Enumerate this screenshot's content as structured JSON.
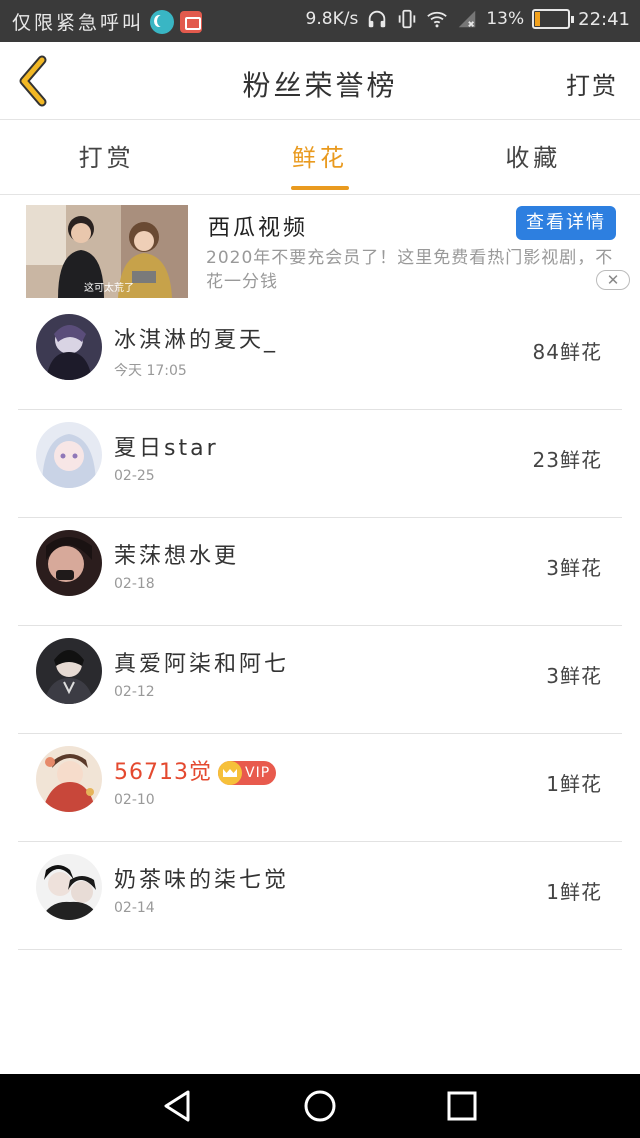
{
  "status_bar": {
    "carrier_text": "仅限紧急呼叫",
    "speed": "9.8K/s",
    "battery_pct": "13%",
    "time": "22:41"
  },
  "navbar": {
    "title": "粉丝荣誉榜",
    "action": "打赏"
  },
  "tabs": [
    {
      "label": "打赏",
      "active": false
    },
    {
      "label": "鲜花",
      "active": true
    },
    {
      "label": "收藏",
      "active": false
    }
  ],
  "ad": {
    "thumb_caption": "这可太荒了",
    "title": "西瓜视频",
    "button": "查看详情",
    "desc": "2020年不要充会员了！这里免费看热门影视剧，不花一分钱",
    "close": "✕"
  },
  "rows": [
    {
      "name": "冰淇淋的夏天_",
      "date": "今天 17:05",
      "count": "84鲜花",
      "vip": false
    },
    {
      "name": "夏日star",
      "date": "02-25",
      "count": "23鲜花",
      "vip": false
    },
    {
      "name": "茉莯想水更",
      "date": "02-18",
      "count": "3鲜花",
      "vip": false
    },
    {
      "name": "真爱阿柒和阿七",
      "date": "02-12",
      "count": "3鲜花",
      "vip": false
    },
    {
      "name": "56713觉",
      "date": "02-10",
      "count": "1鲜花",
      "vip": true,
      "vip_label": "VIP"
    },
    {
      "name": "奶茶味的柒七觉",
      "date": "02-14",
      "count": "1鲜花",
      "vip": false
    }
  ],
  "colors": {
    "accent": "#e99a1f",
    "vip_name": "#e4492f",
    "ad_button": "#2d7fe0",
    "status_bar": "#3a3a3a"
  }
}
